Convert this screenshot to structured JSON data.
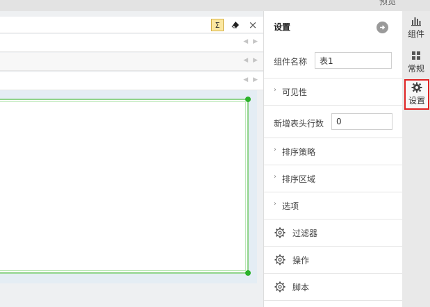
{
  "topbar": {
    "partial_text": "预览 "
  },
  "toolbar": {
    "sum_glyph": "Σ",
    "eraser_glyph": "◆",
    "close_glyph": "×"
  },
  "rows": {
    "arrow_glyph": "◀ ▶"
  },
  "panel": {
    "title": "设置",
    "component_name_label": "组件名称",
    "component_name_value": "表1",
    "visibility_label": "可见性",
    "header_rows_label": "新增表头行数",
    "header_rows_value": "0",
    "sort_strategy_label": "排序策略",
    "sort_region_label": "排序区域",
    "options_label": "选项",
    "filter_label": "过滤器",
    "operation_label": "操作",
    "script_label": "脚本",
    "chevron_glyph": "›"
  },
  "tabs": [
    {
      "label": "组件"
    },
    {
      "label": "常规"
    },
    {
      "label": "设置"
    }
  ],
  "colors": {
    "selection_green": "#2bb22a",
    "highlight_red": "#e02323",
    "sum_yellow": "#fbe7a1"
  }
}
